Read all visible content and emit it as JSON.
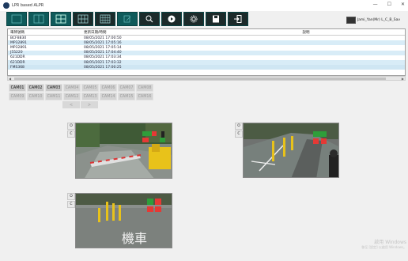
{
  "window": {
    "title": "LPR based ALPR",
    "minimize": "—",
    "maximize": "☐",
    "close": "✕"
  },
  "toolbar": {
    "buttons": [
      {
        "name": "layout-1x1-button",
        "icon": "layout-1x1-icon"
      },
      {
        "name": "layout-2x2-button",
        "icon": "layout-2x2-icon"
      },
      {
        "name": "layout-3x3-button",
        "icon": "layout-3x3-icon"
      },
      {
        "name": "layout-4x4-button",
        "icon": "layout-4x4-icon"
      },
      {
        "name": "layout-5x5-button",
        "icon": "layout-5x5-icon"
      },
      {
        "name": "edit-button",
        "icon": "edit-icon"
      },
      {
        "name": "search-button",
        "icon": "search-icon"
      },
      {
        "name": "play-button",
        "icon": "play-icon"
      },
      {
        "name": "settings-button",
        "icon": "gear-icon"
      },
      {
        "name": "save-button",
        "icon": "save-icon"
      },
      {
        "name": "exit-button",
        "icon": "exit-icon"
      }
    ]
  },
  "user": {
    "label": "Jami_Yan(Mr) L_C_B_Sav"
  },
  "table": {
    "headers": [
      "車牌號碼",
      "更新日期/時間",
      "說明"
    ],
    "rows": [
      [
        "BCF8830",
        "08/05/2021 17:00:50",
        ""
      ],
      [
        "MP32891",
        "08/05/2021 17:05:16",
        ""
      ],
      [
        "MP32891",
        "08/05/2021 17:05:14",
        ""
      ],
      [
        "J55220",
        "08/05/2021 17:04:40",
        ""
      ],
      [
        "621DDR",
        "08/05/2021 17:03:34",
        ""
      ],
      [
        "621DDR",
        "08/05/2021 17:03:32",
        ""
      ],
      [
        "FMS368",
        "08/05/2021 17:00:25",
        ""
      ]
    ]
  },
  "cameras": {
    "row1": [
      "CAM01",
      "CAM02",
      "CAM03",
      "CAM04",
      "CAM05",
      "CAM06",
      "CAM07",
      "CAM08"
    ],
    "row2": [
      "CAM09",
      "CAM10",
      "CAM11",
      "CAM12",
      "CAM13",
      "CAM14",
      "CAM15",
      "CAM16"
    ],
    "active_count": 3,
    "nav_prev": "<",
    "nav_next": ">"
  },
  "views": [
    {
      "open": "O",
      "close": "C"
    },
    {
      "open": "O",
      "close": "C"
    },
    {
      "open": "O",
      "close": "C"
    }
  ],
  "feed_text": {
    "road_marking": "機車"
  },
  "watermark": {
    "line1": "啟用 Windows",
    "line2": "移至 [設定] 以啟用 Windows。"
  },
  "colors": {
    "toolbar_bg": "#0f5a5a",
    "row_highlight": "#d8ecf7",
    "status_red": "#e53935",
    "status_green": "#2e9e3a"
  }
}
